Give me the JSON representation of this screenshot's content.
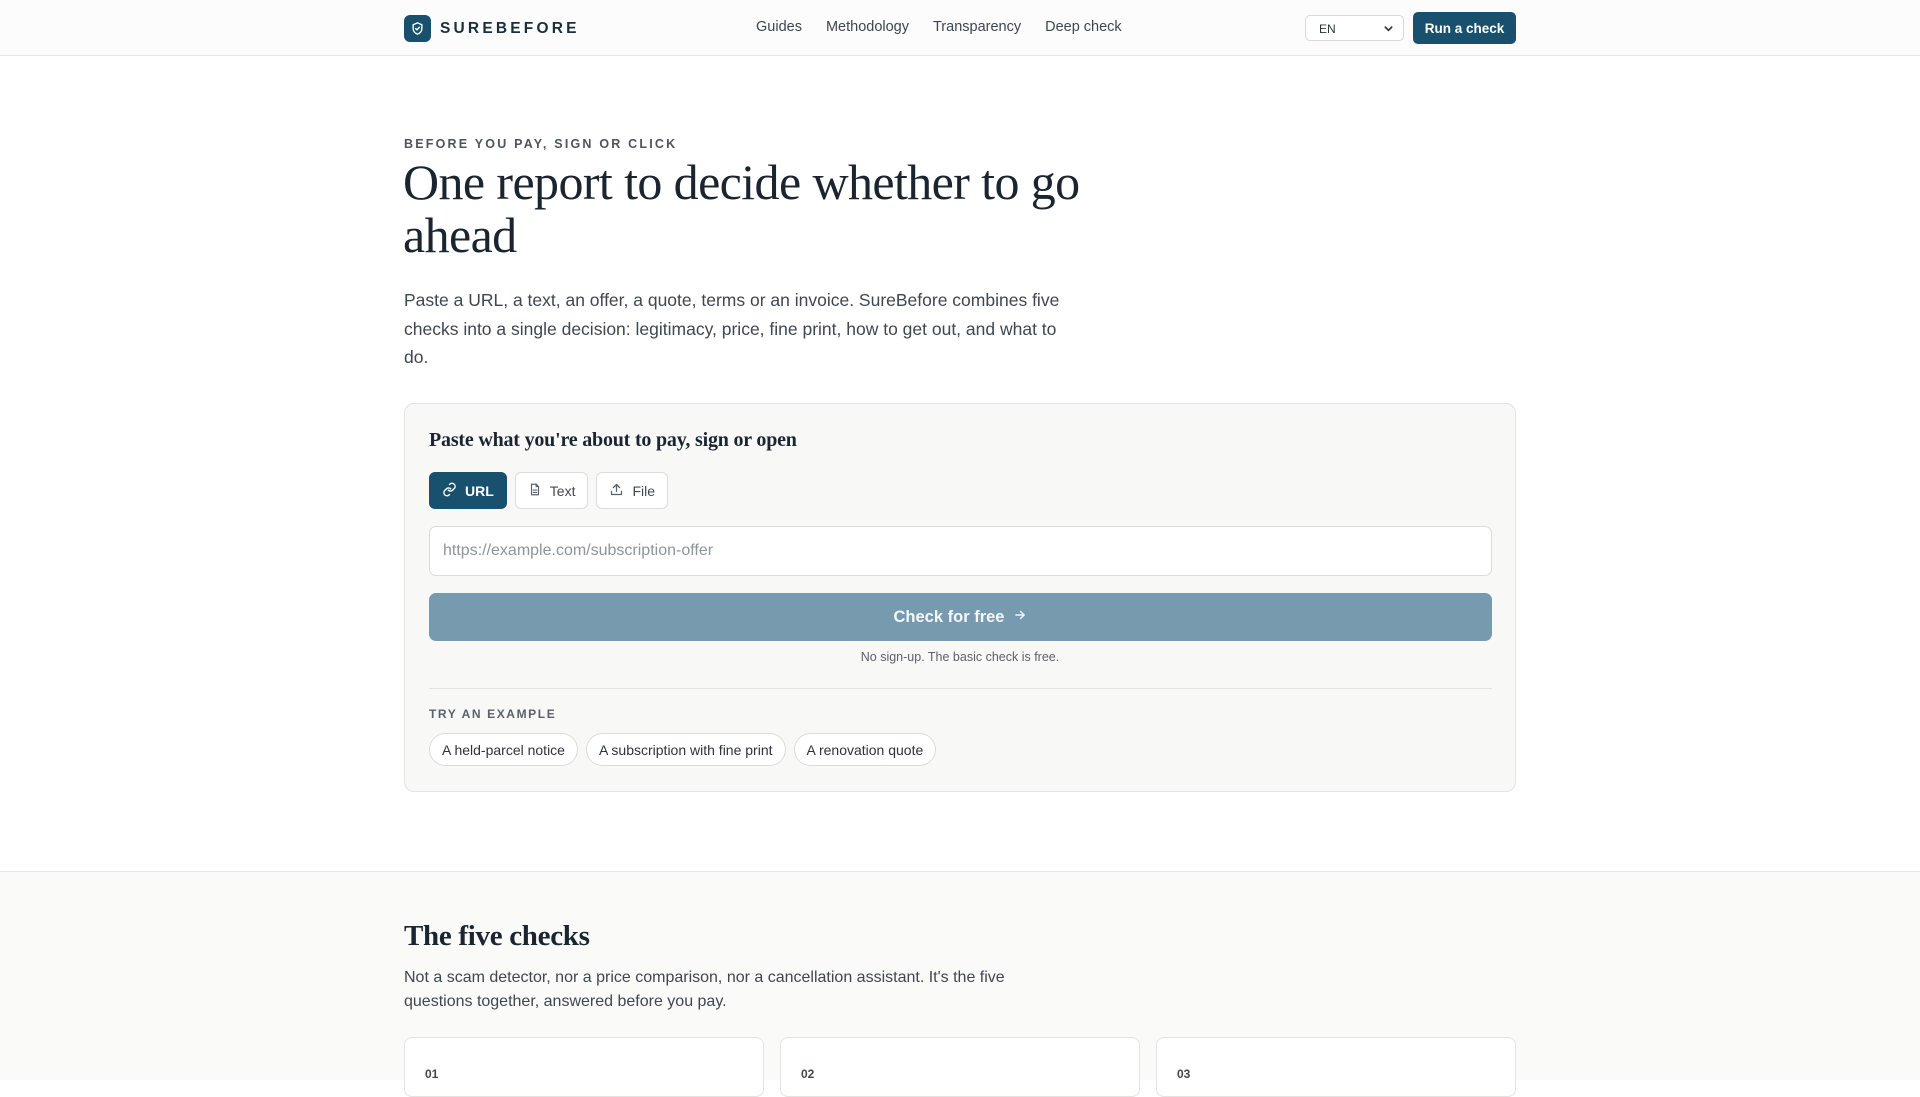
{
  "header": {
    "brand": "SUREBEFORE",
    "nav": [
      "Guides",
      "Methodology",
      "Transparency",
      "Deep check"
    ],
    "language": "EN",
    "cta": "Run a check"
  },
  "hero": {
    "eyebrow": "BEFORE YOU PAY, SIGN OR CLICK",
    "title": "One report to decide whether to go ahead",
    "subtitle": "Paste a URL, a text, an offer, a quote, terms or an invoice. SureBefore combines five checks into a single decision: legitimacy, price, fine print, how to get out, and what to do."
  },
  "checker": {
    "title": "Paste what you're about to pay, sign or open",
    "tabs": [
      {
        "label": "URL",
        "icon": "link-icon",
        "active": true
      },
      {
        "label": "Text",
        "icon": "document-icon",
        "active": false
      },
      {
        "label": "File",
        "icon": "upload-icon",
        "active": false
      }
    ],
    "input_placeholder": "https://example.com/subscription-offer",
    "submit_label": "Check for free",
    "note": "No sign-up. The basic check is free.",
    "examples_label": "TRY AN EXAMPLE",
    "examples": [
      "A held-parcel notice",
      "A subscription with fine print",
      "A renovation quote"
    ]
  },
  "five_checks": {
    "title": "The five checks",
    "subtitle": "Not a scam detector, nor a price comparison, nor a cancellation assistant. It's the five questions together, answered before you pay.",
    "cards": [
      "01",
      "02",
      "03"
    ]
  },
  "colors": {
    "primary": "#18506d",
    "submit_disabled": "#779aaf",
    "page_bg": "#ffffff",
    "card_bg": "#f8f8f7"
  }
}
